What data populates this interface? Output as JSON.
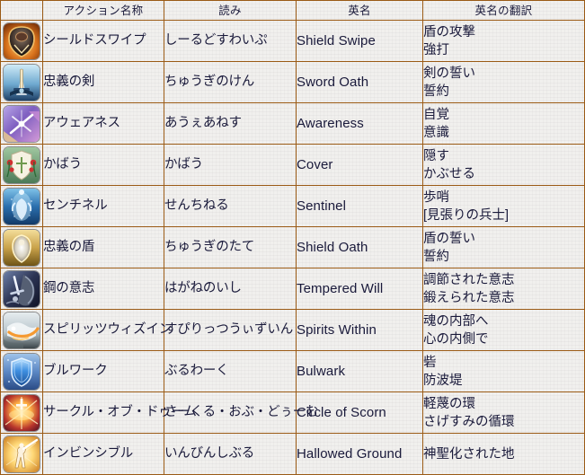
{
  "table": {
    "headers": [
      {
        "key": "icon",
        "label": ""
      },
      {
        "key": "name",
        "label": "アクション名称"
      },
      {
        "key": "kana",
        "label": "読み"
      },
      {
        "key": "en",
        "label": "英名"
      },
      {
        "key": "trans",
        "label": "英名の翻訳"
      }
    ],
    "rows": [
      {
        "icon": "shield-swipe-icon",
        "name": "シールドスワイプ",
        "kana": "しーるどすわいぷ",
        "en": "Shield Swipe",
        "trans_line1": "盾の攻撃",
        "trans_line2": "強打"
      },
      {
        "icon": "sword-oath-icon",
        "name": "忠義の剣",
        "kana": "ちゅうぎのけん",
        "en": "Sword Oath",
        "trans_line1": "剣の誓い",
        "trans_line2": "誓約"
      },
      {
        "icon": "awareness-icon",
        "name": "アウェアネス",
        "kana": "あうぇあねす",
        "en": "Awareness",
        "trans_line1": "自覚",
        "trans_line2": "意識"
      },
      {
        "icon": "cover-icon",
        "name": "かばう",
        "kana": "かばう",
        "en": "Cover",
        "trans_line1": "隠す",
        "trans_line2": "かぶせる"
      },
      {
        "icon": "sentinel-icon",
        "name": "センチネル",
        "kana": "せんちねる",
        "en": "Sentinel",
        "trans_line1": "歩哨",
        "trans_line2": "[見張りの兵士]"
      },
      {
        "icon": "shield-oath-icon",
        "name": "忠義の盾",
        "kana": "ちゅうぎのたて",
        "en": "Shield Oath",
        "trans_line1": "盾の誓い",
        "trans_line2": "誓約"
      },
      {
        "icon": "tempered-will-icon",
        "name": "鋼の意志",
        "kana": "はがねのいし",
        "en": "Tempered Will",
        "trans_line1": "調節された意志",
        "trans_line2": "鍛えられた意志"
      },
      {
        "icon": "spirits-within-icon",
        "name": "スピリッツウィズイン",
        "kana": "すぴりっつうぃずいん",
        "en": "Spirits Within",
        "trans_line1": "魂の内部へ",
        "trans_line2": "心の内側で"
      },
      {
        "icon": "bulwark-icon",
        "name": "ブルワーク",
        "kana": "ぶるわーく",
        "en": "Bulwark",
        "trans_line1": "砦",
        "trans_line2": "防波堤"
      },
      {
        "icon": "circle-of-scorn-icon",
        "name": "サークル・オブ・ドゥーム",
        "kana": "さーくる・おぶ・どぅーむ",
        "en": "Circle of Scorn",
        "trans_line1": "軽蔑の環",
        "trans_line2": "さげすみの循環"
      },
      {
        "icon": "hallowed-ground-icon",
        "name": "インビンシブル",
        "kana": "いんびんしぶる",
        "en": "Hallowed Ground",
        "trans_line1": "神聖化された地",
        "trans_line2": ""
      }
    ]
  },
  "colors": {
    "border": "#9a5a15",
    "text": "#19193a",
    "background": "#f1f0ee"
  }
}
